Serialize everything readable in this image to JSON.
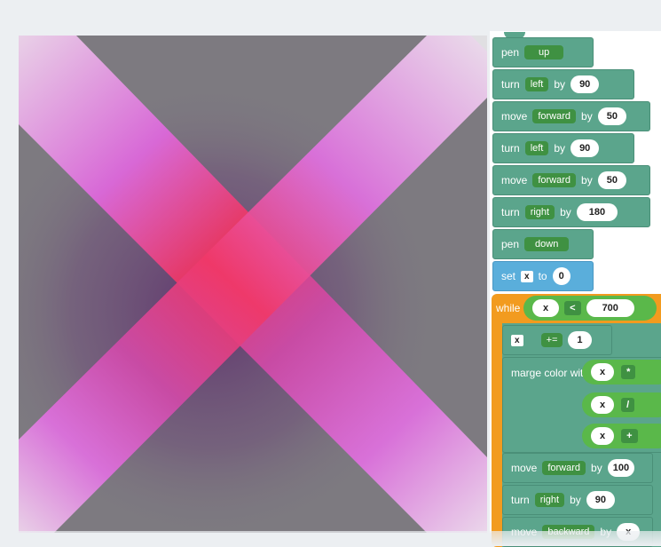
{
  "blocks": [
    {
      "kw": "pen",
      "chip": "up"
    },
    {
      "kw": "turn",
      "chip": "left",
      "by": "by",
      "value": "90"
    },
    {
      "kw": "move",
      "chip": "forward",
      "by": "by",
      "value": "50"
    },
    {
      "kw": "turn",
      "chip": "left",
      "by": "by",
      "value": "90"
    },
    {
      "kw": "move",
      "chip": "forward",
      "by": "by",
      "value": "50"
    },
    {
      "kw": "turn",
      "chip": "right",
      "by": "by",
      "value": "180"
    },
    {
      "kw": "pen",
      "chip": "down"
    }
  ],
  "set_block": {
    "kw": "set",
    "var": "x",
    "to": "to",
    "value": "0"
  },
  "while_block": {
    "kw": "while",
    "left": "x",
    "op": "<",
    "right": "700"
  },
  "inc_block": {
    "var": "x",
    "op": "+=",
    "value": "1"
  },
  "merge_block": {
    "label": "marge color with",
    "rows": [
      {
        "var": "x",
        "op": "*"
      },
      {
        "var": "x",
        "op": "/"
      },
      {
        "var": "x",
        "op": "+"
      }
    ]
  },
  "tail_blocks": [
    {
      "kw": "move",
      "chip": "forward",
      "by": "by",
      "value": "100"
    },
    {
      "kw": "turn",
      "chip": "right",
      "by": "by",
      "value": "90"
    },
    {
      "kw": "move",
      "chip": "backward",
      "by": "by",
      "value": "x"
    }
  ],
  "colors": {
    "motion_block": "#5ba58c",
    "variable_block": "#5aaedb",
    "loop_block": "#f29b1f",
    "operator_block": "#5ab84a",
    "canvas_bg": "#7d7a80",
    "stroke_pink": "#e070e0",
    "stroke_center": "#f03868"
  }
}
